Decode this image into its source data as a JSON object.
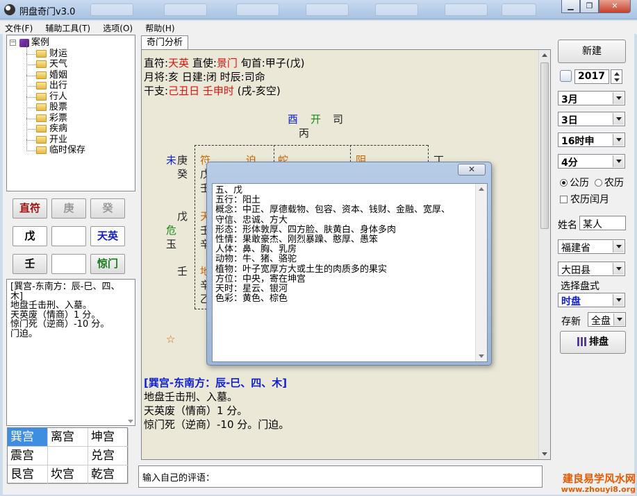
{
  "window": {
    "title": "阴盘奇门v3.0"
  },
  "menu": [
    "文件(F)",
    "辅助工具(T)",
    "选项(O)",
    "帮助(H)"
  ],
  "tree": {
    "root": "案例",
    "items": [
      "财运",
      "天气",
      "婚姻",
      "出行",
      "行人",
      "股票",
      "彩票",
      "疾病",
      "开业",
      "临时保存"
    ]
  },
  "grid_buttons": [
    {
      "label": "直符",
      "color": "#a01010"
    },
    {
      "label": "庚",
      "color": "#999999"
    },
    {
      "label": "癸",
      "color": "#999999"
    },
    {
      "label": "戊",
      "color": "#000000"
    },
    {
      "label": "",
      "color": "#000000"
    },
    {
      "label": "天英",
      "color": "#1020c8"
    },
    {
      "label": "壬",
      "color": "#000000"
    },
    {
      "label": "",
      "color": "#000000"
    },
    {
      "label": "惊门",
      "color": "#157a15"
    }
  ],
  "left_desc": {
    "lines": [
      "[巽宫-东南方：辰-巳、四、",
      "木]",
      "地盘壬击刑、入墓。",
      "天英废（情商）1 分。",
      "惊门死（逆商）-10 分。",
      "门迫。"
    ]
  },
  "palaces": [
    "巽宫",
    "离宫",
    "坤宫",
    "震宫",
    "",
    "兑宫",
    "艮宫",
    "坎宫",
    "乾宫"
  ],
  "center": {
    "tab": "奇门分析",
    "header": {
      "l1_a": "直符:",
      "l1_b": "天英",
      "l1_c": " 直使:",
      "l1_d": "景门",
      "l1_e": " 旬首:甲子(戊)",
      "l2": "月将:亥 日建:闭 时辰:司命",
      "l3_a": "干支:",
      "l3_b": "己丑日 壬申时",
      "l3_c": " (戌-亥空)"
    },
    "top_palace": {
      "a": "酉",
      "b": "开",
      "c": "司",
      "d": "丙"
    },
    "left_col": {
      "a": "未",
      "b": "庚",
      "c": "癸",
      "d": "戊",
      "e": "危",
      "f": "玉",
      "g": "壬",
      "h": "☆"
    },
    "cells": {
      "c1": "符",
      "c2": "迫",
      "c3": "蛇",
      "c4": "阴",
      "c5": "丁",
      "c6": "戊",
      "c7": "壬",
      "c8": "天",
      "c9": "壬",
      "c10": "辛",
      "c11": "地",
      "c12": "辛",
      "c13": "乙"
    },
    "bottom": {
      "heading": "[巽宫-东南方：辰-巳、四、木]",
      "lines": [
        "地盘壬击刑、入墓。",
        "天英废（情商）1 分。",
        "惊门死（逆商）-10 分。门迫。"
      ]
    },
    "comment_label": "输入自己的评语："
  },
  "popup": {
    "lines": [
      "五、戊",
      "五行：阳土",
      "概念：中正、厚德载物、包容、资本、钱财、金融、宽厚、",
      "守信、忠诚、方大",
      "形态：形体敦厚、四方脸、肤黄白、身体多肉",
      "性情：果敢豪杰、刚烈暴躁、憨厚、愚笨",
      "人体：鼻、胸、乳房",
      "动物：牛、猪、骆驼",
      "植物：叶子宽厚方大或土生的肉质多的果实",
      "方位：中央，寄在坤宫",
      "天时：星云、银河",
      "色彩：黄色、棕色"
    ]
  },
  "right": {
    "new_button": "新建",
    "year": "2017",
    "month": "3月",
    "day": "3日",
    "hour": "16时申",
    "minute": "4分",
    "calendar_solar": "公历",
    "calendar_lunar": "农历",
    "leap_month": "农历闰月",
    "name_label": "姓名",
    "name_value": "某人",
    "province": "福建省",
    "county": "大田县",
    "chart_type_label": "选择盘式",
    "chart_type": "时盘",
    "save_label": "存新",
    "save_value": "全盘",
    "arrange_button": "排盘"
  },
  "watermark": {
    "line1": "建良易学风水网",
    "line2": "www.zhouyi8.org"
  }
}
